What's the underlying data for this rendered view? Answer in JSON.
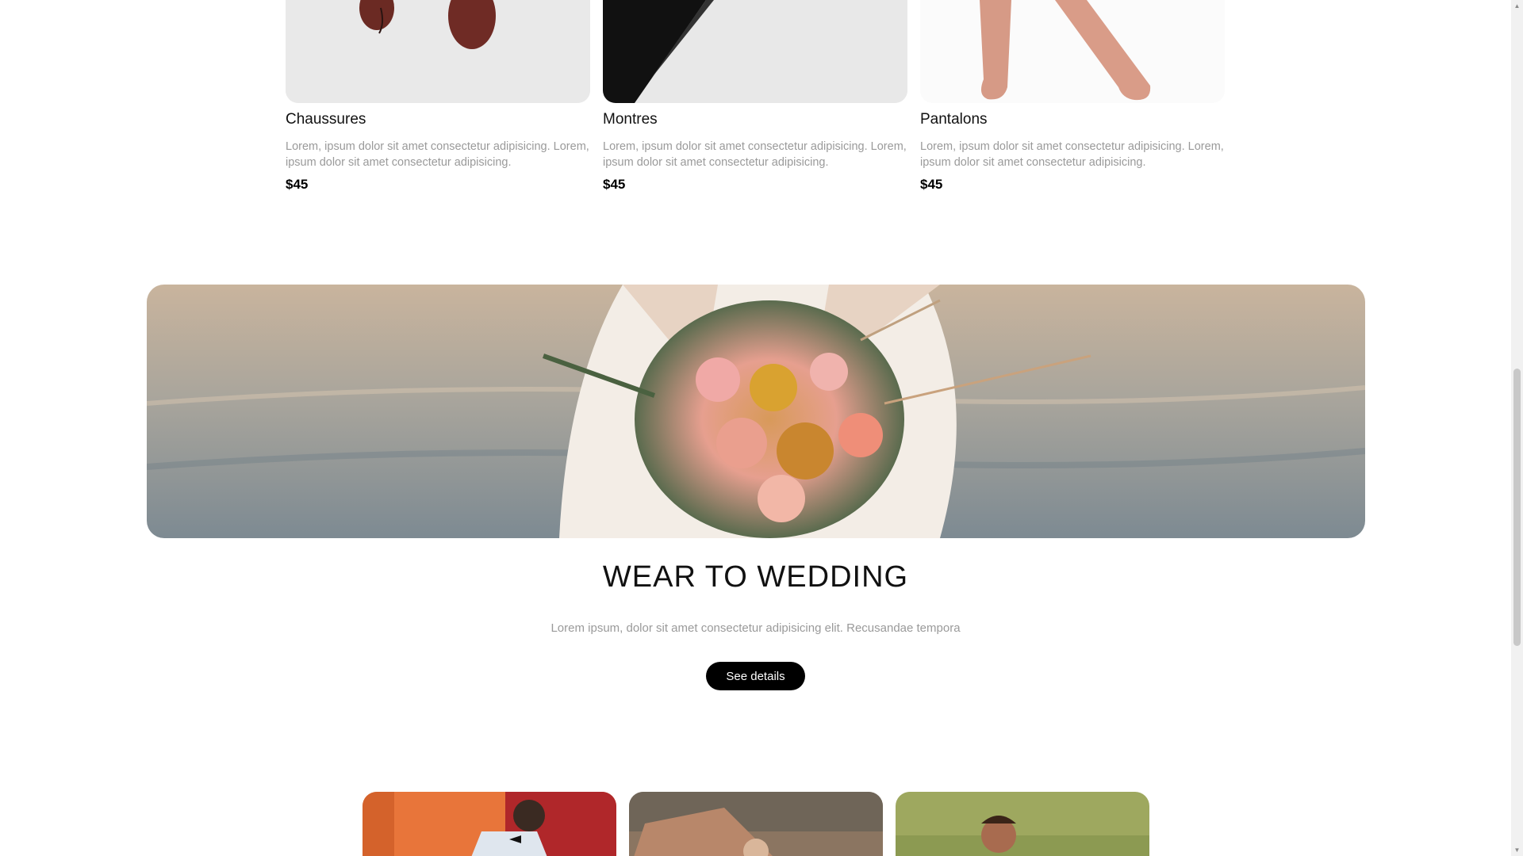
{
  "products": [
    {
      "name": "Chaussures",
      "description": "Lorem, ipsum dolor sit amet consectetur adipisicing. Lorem, ipsum dolor sit amet consectetur adipisicing.",
      "price": "$45",
      "image": "shoes-photo"
    },
    {
      "name": "Montres",
      "description": "Lorem, ipsum dolor sit amet consectetur adipisicing. Lorem, ipsum dolor sit amet consectetur adipisicing.",
      "price": "$45",
      "image": "watch-photo"
    },
    {
      "name": "Pantalons",
      "description": "Lorem, ipsum dolor sit amet consectetur adipisicing. Lorem, ipsum dolor sit amet consectetur adipisicing.",
      "price": "$45",
      "image": "pants-photo"
    }
  ],
  "banner": {
    "image": "wedding-bouquet-photo"
  },
  "wedding": {
    "title": "WEAR TO WEDDING",
    "description": "Lorem ipsum, dolor sit amet consectetur adipisicing elit. Recusandae tempora",
    "button_label": "See details"
  },
  "gallery": [
    {
      "image": "man-orange-wall-photo"
    },
    {
      "image": "woman-stone-wall-photo"
    },
    {
      "image": "boy-grass-photo"
    }
  ],
  "scrollbar": {
    "up_icon": "chevron-up-icon",
    "down_icon": "chevron-down-icon"
  }
}
